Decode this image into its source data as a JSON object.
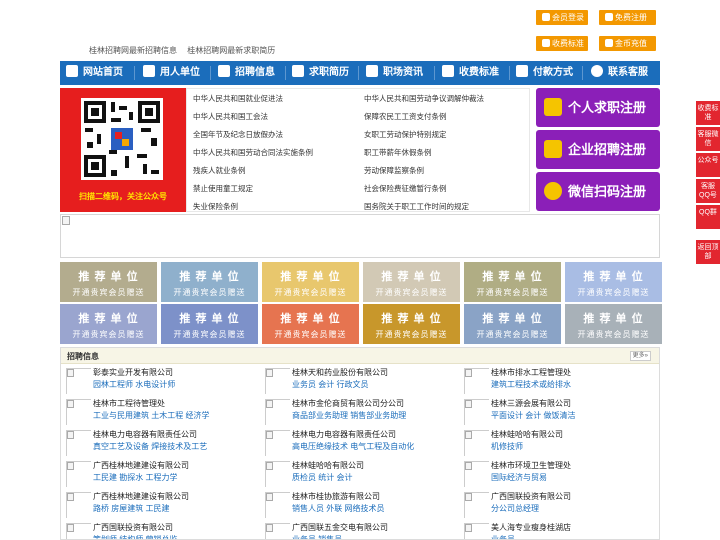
{
  "top_buttons": {
    "login": "会员登录",
    "register": "免费注册",
    "pricing": "收费标准",
    "recharge": "金币充值"
  },
  "sub_links": [
    "桂林招聘网最新招聘信息",
    "桂林招聘网最新求职简历"
  ],
  "nav": [
    "网站首页",
    "用人单位",
    "招聘信息",
    "求职简历",
    "职场资讯",
    "收费标准",
    "付款方式",
    "联系客服"
  ],
  "qr_caption": "扫描二维码，关注公众号",
  "laws_left": [
    "中华人民共和国就业促进法",
    "中华人民共和国工会法",
    "全国年节及纪念日放假办法",
    "中华人民共和国劳动合同法实施条例",
    "残疾人就业条例",
    "禁止使用童工规定",
    "失业保险条例"
  ],
  "laws_right": [
    "中华人民共和国劳动争议调解仲裁法",
    "保障农民工工资支付条例",
    "女职工劳动保护特别规定",
    "职工带薪年休假条例",
    "劳动保障监察条例",
    "社会保险费征缴暂行条例",
    "国务院关于职工工作时间的规定"
  ],
  "big_buttons": [
    "个人求职注册",
    "企业招聘注册",
    "微信扫码注册"
  ],
  "recommend": {
    "title": "推 荐 单 位",
    "subtitle": "开通贵宾会员赠送",
    "colors_row1": [
      "#b3ac8e",
      "#8fb0cc",
      "#e8c76d",
      "#d2c9b5",
      "#b0ad84",
      "#a9bde4"
    ],
    "colors_row2": [
      "#9aa5cf",
      "#7d91c9",
      "#e67450",
      "#c8972b",
      "#8aa3c6",
      "#a8b1b8"
    ]
  },
  "jobs_section": {
    "title": "招聘信息",
    "more": "更多»",
    "columns": [
      [
        {
          "company": "彰泰实业开发有限公司",
          "jobs": "园林工程师 水电设计师"
        },
        {
          "company": "桂林市工程待管理处",
          "jobs": "工业与民用建筑 土木工程 经济学"
        },
        {
          "company": "桂林电力电容器有限责任公司",
          "jobs": "真空工艺及设备 焊接技术及工艺"
        },
        {
          "company": "广西桂林地建建设有限公司",
          "jobs": "工民建 勘探水 工程力学"
        },
        {
          "company": "广西桂林地建建设有限公司",
          "jobs": "路桥 房屋建筑 工民建"
        },
        {
          "company": "广西国联投资有限公司",
          "jobs": "策划师 结构师 营销总监"
        }
      ],
      [
        {
          "company": "桂林天和药业股份有限公司",
          "jobs": "业务员 会计 行政文员"
        },
        {
          "company": "桂林市金伦商贸有限公司分公司",
          "jobs": "商品部业务助理 销售部业务助理"
        },
        {
          "company": "桂林电力电容器有限责任公司",
          "jobs": "高电压绝缘技术 电气工程及自动化"
        },
        {
          "company": "桂林蛙哈哈有限公司",
          "jobs": "质检员 统计 会计"
        },
        {
          "company": "桂林市桂协旅游有限公司",
          "jobs": "销售人员 外联 网络技术员"
        },
        {
          "company": "广西国联五金交电有限公司",
          "jobs": "业务员 销售员"
        }
      ],
      [
        {
          "company": "桂林市排水工程管理处",
          "jobs": "建筑工程技术或给排水"
        },
        {
          "company": "桂林三源会展有限公司",
          "jobs": "平面设计 会计 做饭清洁"
        },
        {
          "company": "桂林蛙哈哈有限公司",
          "jobs": "机修技师"
        },
        {
          "company": "桂林市环境卫生管理处",
          "jobs": "国际经济与贸易"
        },
        {
          "company": "广西国联投资有限公司",
          "jobs": "分公司总经理"
        },
        {
          "company": "美人海专业瘦身桂湖店",
          "jobs": "业务员"
        }
      ]
    ]
  },
  "side_bar": [
    "收费标准",
    "客服微信",
    "公众号",
    "客服QQ号",
    "QQ群",
    "返回顶部"
  ]
}
